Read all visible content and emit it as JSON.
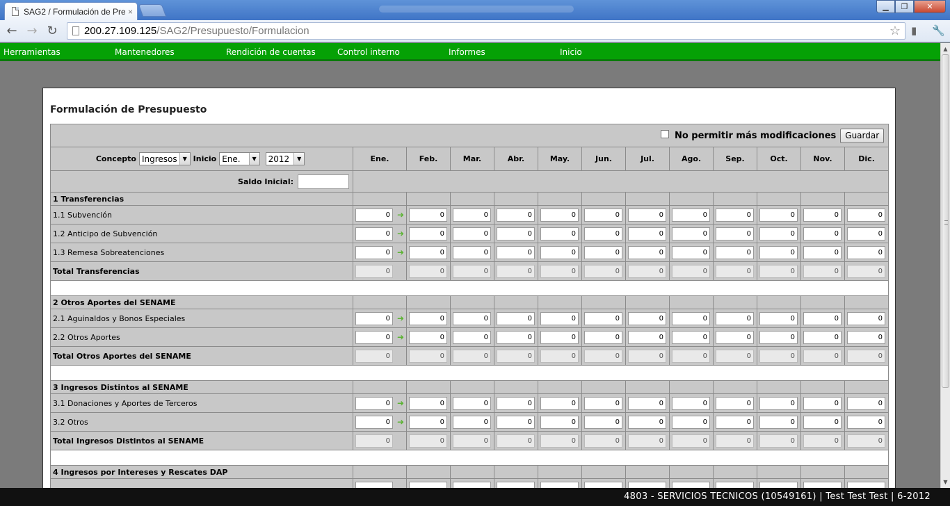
{
  "browser": {
    "tab_title": "SAG2 / Formulación de Pre",
    "tab_close": "×",
    "url_host": "200.27.109.125",
    "url_path": "/SAG2/Presupuesto/Formulacion"
  },
  "menu": {
    "items": [
      "Herramientas",
      "Mantenedores",
      "Rendición de cuentas",
      "Control interno",
      "Informes",
      "Inicio"
    ]
  },
  "page": {
    "title": "Formulación de Presupuesto",
    "no_modificar_label": "No permitir más modificaciones",
    "guardar_label": "Guardar",
    "concepto_label": "Concepto",
    "concepto_value": "Ingresos",
    "inicio_label": "Inicio",
    "inicio_mes": "Ene.",
    "inicio_anio": "2012",
    "saldo_label": "Saldo Inicial:",
    "saldo_value": ""
  },
  "months": [
    "Ene.",
    "Feb.",
    "Mar.",
    "Abr.",
    "May.",
    "Jun.",
    "Jul.",
    "Ago.",
    "Sep.",
    "Oct.",
    "Nov.",
    "Dic."
  ],
  "sections": [
    {
      "title": "1 Transferencias",
      "items": [
        {
          "label": "1.1 Subvención",
          "values": [
            "0",
            "0",
            "0",
            "0",
            "0",
            "0",
            "0",
            "0",
            "0",
            "0",
            "0",
            "0"
          ]
        },
        {
          "label": "1.2 Anticipo de Subvención",
          "values": [
            "0",
            "0",
            "0",
            "0",
            "0",
            "0",
            "0",
            "0",
            "0",
            "0",
            "0",
            "0"
          ]
        },
        {
          "label": "1.3 Remesa Sobreatenciones",
          "values": [
            "0",
            "0",
            "0",
            "0",
            "0",
            "0",
            "0",
            "0",
            "0",
            "0",
            "0",
            "0"
          ]
        }
      ],
      "total_label": "Total Transferencias",
      "total_values": [
        "0",
        "0",
        "0",
        "0",
        "0",
        "0",
        "0",
        "0",
        "0",
        "0",
        "0",
        "0"
      ]
    },
    {
      "title": "2 Otros Aportes del SENAME",
      "items": [
        {
          "label": "2.1 Aguinaldos y Bonos Especiales",
          "values": [
            "0",
            "0",
            "0",
            "0",
            "0",
            "0",
            "0",
            "0",
            "0",
            "0",
            "0",
            "0"
          ]
        },
        {
          "label": "2.2 Otros Aportes",
          "values": [
            "0",
            "0",
            "0",
            "0",
            "0",
            "0",
            "0",
            "0",
            "0",
            "0",
            "0",
            "0"
          ]
        }
      ],
      "total_label": "Total Otros Aportes del SENAME",
      "total_values": [
        "0",
        "0",
        "0",
        "0",
        "0",
        "0",
        "0",
        "0",
        "0",
        "0",
        "0",
        "0"
      ]
    },
    {
      "title": "3 Ingresos Distintos al SENAME",
      "items": [
        {
          "label": "3.1 Donaciones y Aportes de Terceros",
          "values": [
            "0",
            "0",
            "0",
            "0",
            "0",
            "0",
            "0",
            "0",
            "0",
            "0",
            "0",
            "0"
          ]
        },
        {
          "label": "3.2 Otros",
          "values": [
            "0",
            "0",
            "0",
            "0",
            "0",
            "0",
            "0",
            "0",
            "0",
            "0",
            "0",
            "0"
          ]
        }
      ],
      "total_label": "Total Ingresos Distintos al SENAME",
      "total_values": [
        "0",
        "0",
        "0",
        "0",
        "0",
        "0",
        "0",
        "0",
        "0",
        "0",
        "0",
        "0"
      ]
    },
    {
      "title": "4 Ingresos por Intereses y Rescates DAP",
      "items": [],
      "total_label": "",
      "total_values": []
    }
  ],
  "status_bar": "4803 - SERVICIOS TECNICOS (10549161) | Test Test Test | 6-2012",
  "colors": {
    "menu_green": "#05a105",
    "table_gray": "#c8c8c8",
    "arrow_green": "#5cb334"
  },
  "icons": {
    "copy_arrow": "arrow-right-icon",
    "star": "star-icon",
    "wrench": "wrench-icon"
  }
}
